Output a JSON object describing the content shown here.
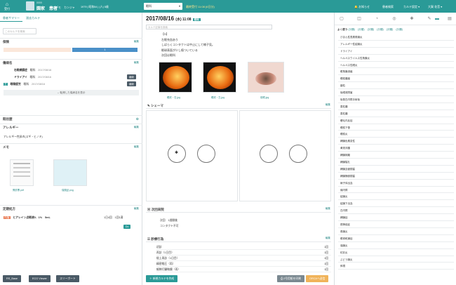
{
  "topbar": {
    "logo_label": "受付",
    "patient_id": "0000",
    "patient_name": "園家　患者",
    "patient_kana": "コデモ　カンジャ",
    "patient_info": "1979 | 昭和54 | (人)  5歳",
    "dept_select": "眼科",
    "visit_text": "最終受付 11:08  (6日分)",
    "notify": "お知らせ",
    "reception": "患者検索",
    "karte_setting": "カルテ設定",
    "user": "大賀 花音"
  },
  "left": {
    "tabs": [
      "患者サマリー",
      "過去カルテ"
    ],
    "search_placeholder": "このカルテを検索",
    "sections": {
      "insurance": "保険",
      "disease": "傷病名",
      "history": "既往歴",
      "allergy": "アレルギー",
      "memo": "メモ",
      "rx": "定期処方"
    },
    "edit_label": "編集",
    "insurance_bar_label": "1",
    "disease_rows": [
      {
        "label": "右眼網膜症",
        "dept": "眼科",
        "date": "2017/08/16"
      },
      {
        "label": "ドライアイ",
        "dept": "眼科",
        "date": "2017/08/16"
      },
      {
        "label": "眼精疲労",
        "dept": "眼科",
        "date": "2017/08/16"
      }
    ],
    "disease_badge": "主",
    "btn_edit_small": "継続",
    "more_label": "転帰した傷病名を表示",
    "allergy_text": "アレルギー性鼻炎(スギ・ヒノキ)",
    "memo_files": [
      "問診票.pdf",
      "保険証.png"
    ],
    "rx_badge": "内服",
    "rx_text": "ヒアレイン点眼液0．1%　5mL",
    "rx_qty": "1日4回　1回1滴",
    "rx_ok": "Do",
    "footer": [
      "RS_Base",
      "ECG Viewer",
      "スリーポート"
    ]
  },
  "mid": {
    "date": "2017/08/16",
    "date_suffix": "(水) 11:08",
    "badge": "眼科",
    "badge2": "後",
    "search_placeholder": "カルテ記事を検索",
    "note_lines": [
      "【S】",
      "左眼充血あり",
      "しばらくコンタクトは中止にして様子見。",
      "眼球表面が少し傷ついている",
      "次回は眼科"
    ],
    "images": [
      "眼底・右.jpg",
      "眼底・左.jpg",
      "前眼.jpg"
    ],
    "schema_title": "シェーマ",
    "next_title": "次回来院",
    "next_lines": [
      "次回　1週間後",
      "コンタクト不可"
    ],
    "billing_title": "診療行為",
    "billing_rows": [
      {
        "name": "初診",
        "val": "1回"
      },
      {
        "name": "再診（1日目）",
        "val": "1回"
      },
      {
        "name": "極上再診（1日目）",
        "val": "1回"
      },
      {
        "name": "精密眼圧（両）",
        "val": "1回"
      },
      {
        "name": "細隙灯顕微鏡（両）",
        "val": "1回"
      }
    ],
    "edit_label": "編集",
    "footer_new": "新規カルテを作成",
    "footer_prev": "2号用紙を印刷",
    "footer_save": "ORCAへ送信"
  },
  "right": {
    "chips_prefix": "よく使う",
    "chips": [
      "(分類)",
      "(分類)",
      "(分類)",
      "(分類)",
      "(分類)",
      "(分類)"
    ],
    "items": [
      "びまん性表層角膜炎",
      "アレルギー性結膜炎",
      "ドライアイ",
      "ヘルペスウイルス性角膜炎",
      "ヘルペス性眼炎",
      "眼角膜潰瘍",
      "眼瞼腫瘍",
      "霰粒",
      "後眼底障害",
      "後発白内障手術後",
      "麦粒腫",
      "麦粒腫",
      "睫毛内反症",
      "眼瞼下垂",
      "眼瞼炎",
      "網膜色素変性",
      "黄斑浮腫",
      "網膜剥離",
      "網膜裂孔",
      "網膜血管閉塞",
      "網膜静脈閉塞",
      "硝子体出血",
      "緑内障",
      "結膜炎",
      "結膜下出血",
      "白内障",
      "網膜症",
      "視神経症",
      "角膜炎",
      "眼球乾燥症",
      "強膜炎",
      "虹彩炎",
      "ぶどう膜炎",
      "斜視"
    ]
  },
  "colors": {
    "accent": "#2a9a97",
    "insurance_bar": "#4a90c8",
    "save": "#f0b35a",
    "rx_badge": "#e8734a"
  }
}
